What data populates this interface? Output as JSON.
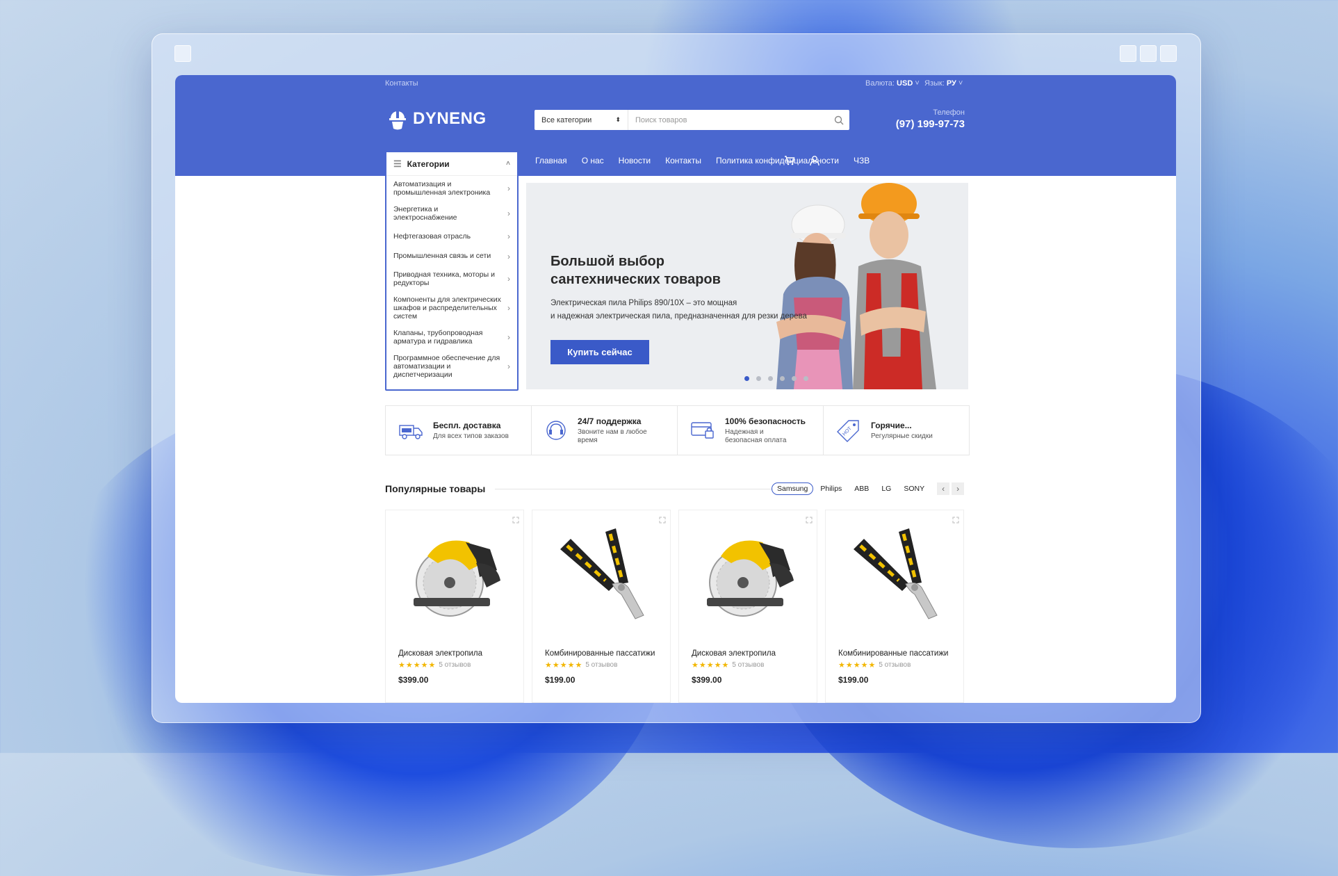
{
  "header": {
    "top_link": "Контакты",
    "currency_label": "Валюта:",
    "currency_value": "USD",
    "lang_label": "Язык:",
    "lang_value": "РУ",
    "logo": "DYNENG",
    "search": {
      "category": "Все категории",
      "placeholder": "Поиск товаров"
    },
    "phone_label": "Телефон",
    "phone": "(97) 199-97-73",
    "nav": [
      "Главная",
      "О нас",
      "Новости",
      "Контакты",
      "Политика конфиденциальности",
      "ЧЗВ"
    ],
    "categories_label": "Категории"
  },
  "categories": [
    "Автоматизация и промышленная электроника",
    "Энергетика и электроснабжение",
    "Нефтегазовая отрасль",
    "Промышленная связь и сети",
    "Приводная техника, моторы и редукторы",
    "Компоненты для электрических шкафов и распределительных систем",
    "Клапаны, трубопроводная арматура и гидравлика",
    "Программное обеспечение для автоматизации и диспетчеризации"
  ],
  "banner": {
    "title": "Большой выбор сантехнических товаров",
    "text1": "Электрическая пила Philips 890/10X – это мощная",
    "text2": "и надежная электрическая пила, предназначенная для резки дерева",
    "button": "Купить сейчас"
  },
  "features": [
    {
      "title": "Беспл. доставка",
      "sub": "Для всех типов заказов",
      "icon": "truck-icon"
    },
    {
      "title": "24/7 поддержка",
      "sub": "Звоните нам в любое время",
      "icon": "support-icon"
    },
    {
      "title": "100% безопасность",
      "sub": "Надежная и безопасная оплата",
      "icon": "card-icon"
    },
    {
      "title": "Горячие...",
      "sub": "Регулярные скидки",
      "icon": "tag-icon"
    }
  ],
  "popular": {
    "title": "Популярные товары",
    "brands": [
      "Samsung",
      "Philips",
      "ABB",
      "LG",
      "SONY"
    ],
    "active_brand": "Samsung"
  },
  "products": [
    {
      "name": "Дисковая электропила",
      "reviews": "5 отзывов",
      "price": "$399.00",
      "rating": 5,
      "type": "saw"
    },
    {
      "name": "Комбинированные пассатижи",
      "reviews": "5 отзывов",
      "price": "$199.00",
      "rating": 5,
      "type": "pliers"
    },
    {
      "name": "Дисковая электропила",
      "reviews": "5 отзывов",
      "price": "$399.00",
      "rating": 5,
      "type": "saw"
    },
    {
      "name": "Комбинированные пассатижи",
      "reviews": "5 отзывов",
      "price": "$199.00",
      "rating": 5,
      "type": "pliers"
    }
  ],
  "colors": {
    "brand": "#4a67cf",
    "button": "#3a5ac8",
    "star": "#f2b600"
  }
}
